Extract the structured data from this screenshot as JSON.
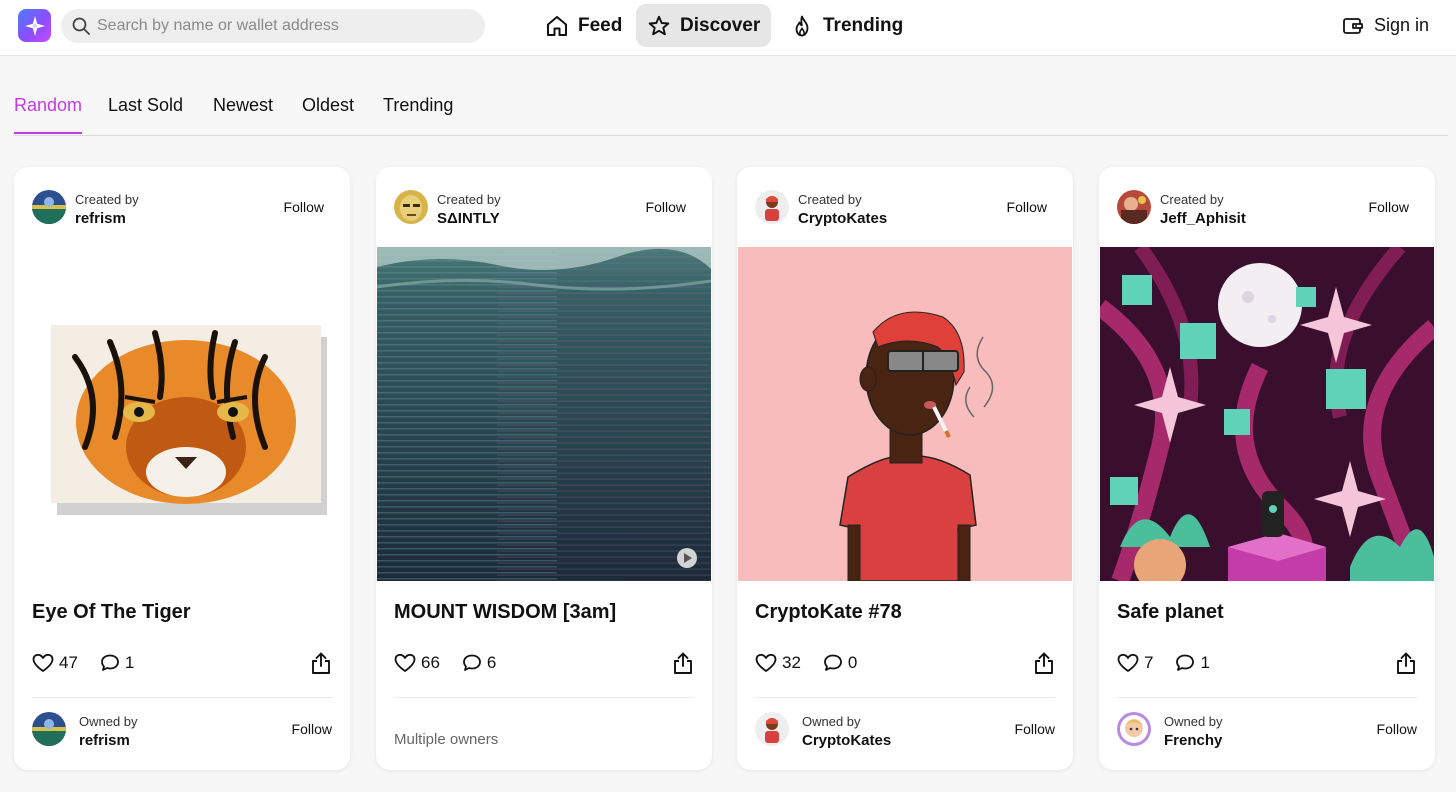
{
  "app": {
    "logo_icon": "sparkle-logo-icon",
    "accent_color": "#c43ce0"
  },
  "search": {
    "placeholder": "Search by name or wallet address",
    "value": ""
  },
  "nav": {
    "feed": "Feed",
    "discover": "Discover",
    "trending": "Trending",
    "active": "Discover"
  },
  "auth": {
    "sign_in": "Sign in"
  },
  "tabs": [
    {
      "label": "Random",
      "active": true
    },
    {
      "label": "Last Sold",
      "active": false
    },
    {
      "label": "Newest",
      "active": false
    },
    {
      "label": "Oldest",
      "active": false
    },
    {
      "label": "Trending",
      "active": false
    }
  ],
  "labels": {
    "created_by": "Created by",
    "owned_by": "Owned by",
    "follow": "Follow"
  },
  "cards": [
    {
      "creator": "refrism",
      "title": "Eye Of The Tiger",
      "likes": "47",
      "comments": "1",
      "owner": "refrism",
      "has_video": false
    },
    {
      "creator": "SΔINTLY",
      "title": "MOUNT WISDOM [3am]",
      "likes": "66",
      "comments": "6",
      "owners_text": "Multiple owners",
      "has_video": true
    },
    {
      "creator": "CryptoKates",
      "title": "CryptoKate #78",
      "likes": "32",
      "comments": "0",
      "owner": "CryptoKates",
      "has_video": false
    },
    {
      "creator": "Jeff_Aphisit",
      "title": "Safe planet",
      "likes": "7",
      "comments": "1",
      "owner": "Frenchy",
      "has_video": false
    }
  ]
}
